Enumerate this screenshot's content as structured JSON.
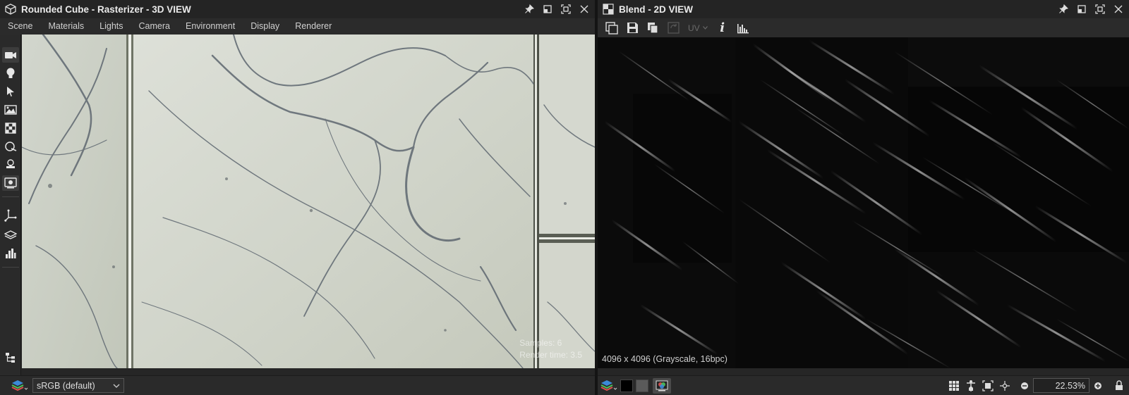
{
  "left_panel": {
    "title": "Rounded Cube - Rasterizer - 3D VIEW",
    "menu": [
      "Scene",
      "Materials",
      "Lights",
      "Camera",
      "Environment",
      "Display",
      "Renderer"
    ],
    "overlay": {
      "samples": "Samples: 6",
      "render_time": "Render time: 3.5"
    },
    "colorspace": "sRGB (default)",
    "tools": [
      "camera-icon",
      "light-icon",
      "select-arrow-icon",
      "environment-icon",
      "texture-icon",
      "material-sphere-icon",
      "stamp-icon",
      "render-settings-icon",
      "axis-icon",
      "layers-icon",
      "histogram-icon",
      "hierarchy-icon"
    ]
  },
  "right_panel": {
    "title": "Blend - 2D VIEW",
    "toolbar": {
      "uv_label": "UV",
      "info_label": "i"
    },
    "image_info": "4096 x 4096 (Grayscale, 16bpc)",
    "zoom": "22.53%"
  },
  "colors": {
    "background": "#262626",
    "title_bar": "#242424",
    "accent": "#4a90d9"
  }
}
